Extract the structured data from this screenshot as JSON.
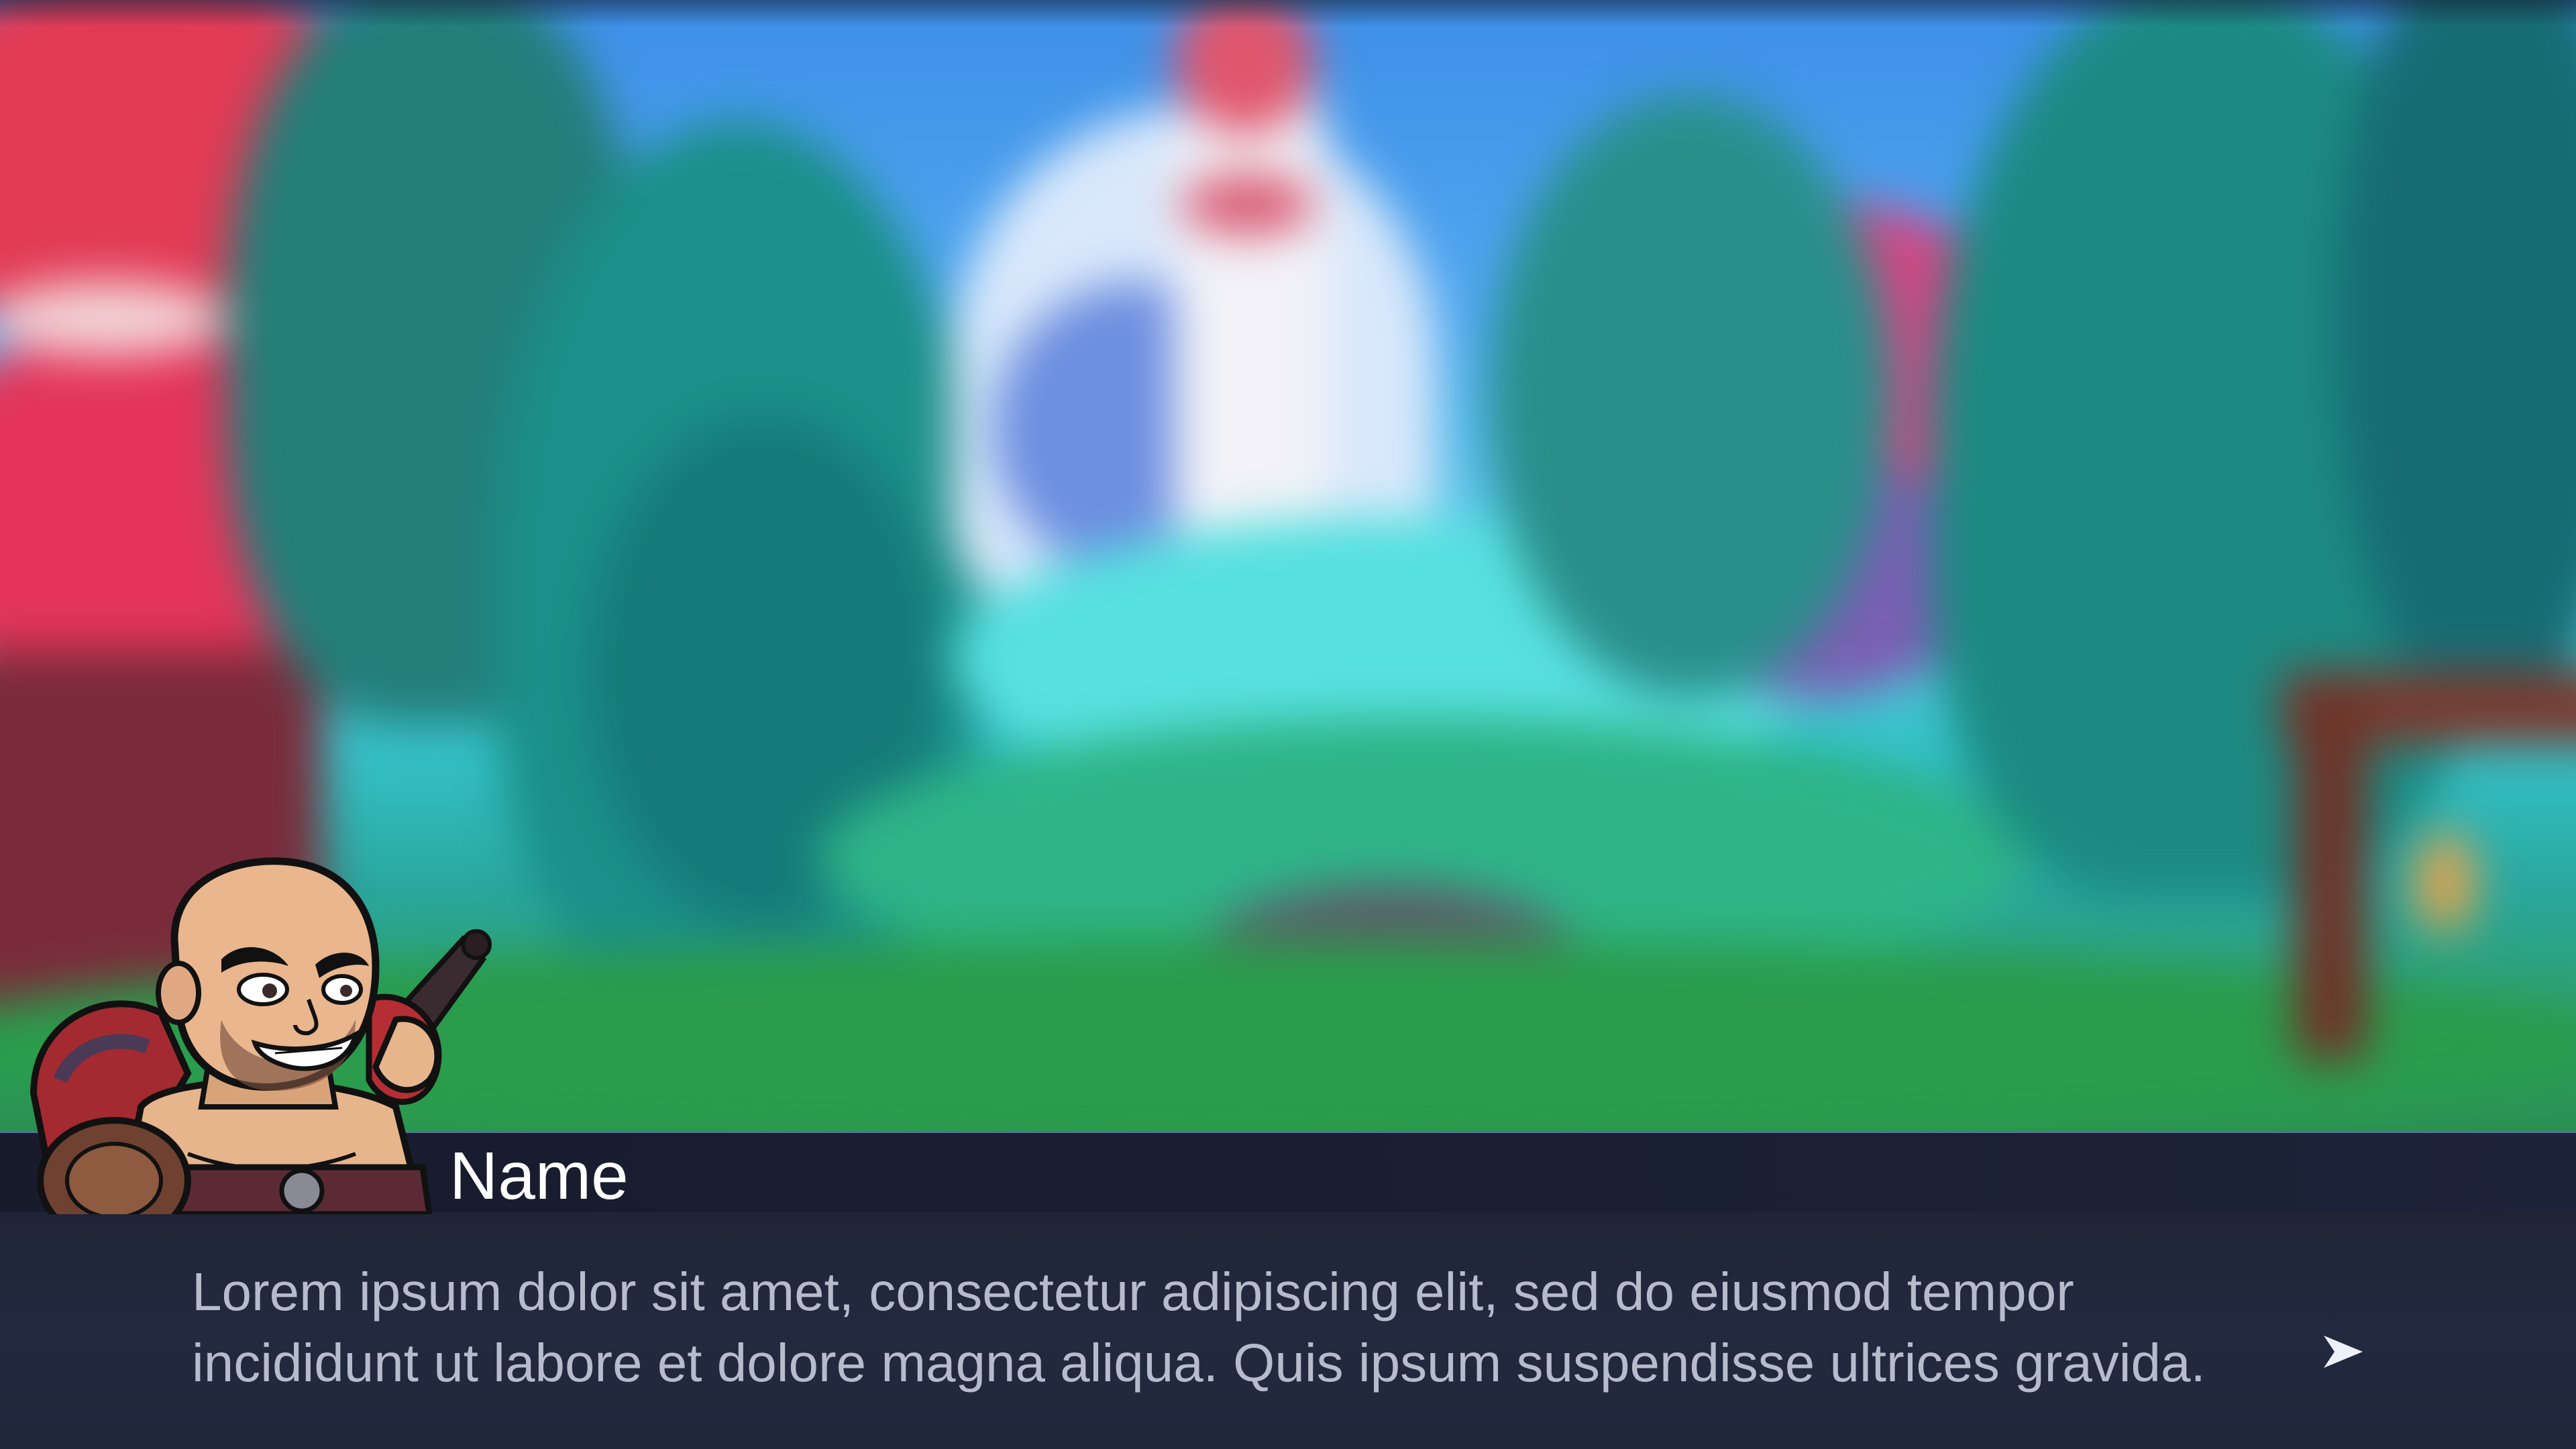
{
  "dialogue": {
    "speaker_name": "Name",
    "text_line_1": "Lorem ipsum dolor sit amet, consectetur adipiscing elit, sed do eiusmod tempor",
    "text_line_2": "incididunt ut labore et dolore magna aliqua. Quis ipsum suspendisse ultrices gravida.",
    "advance_icon": "play-arrow-icon"
  },
  "colors": {
    "name_bar": "#1a1f33",
    "text_box": "#232a40",
    "divider": "#6e82b8",
    "dialogue_text": "#b6bccd",
    "speaker_text": "#ffffff"
  }
}
